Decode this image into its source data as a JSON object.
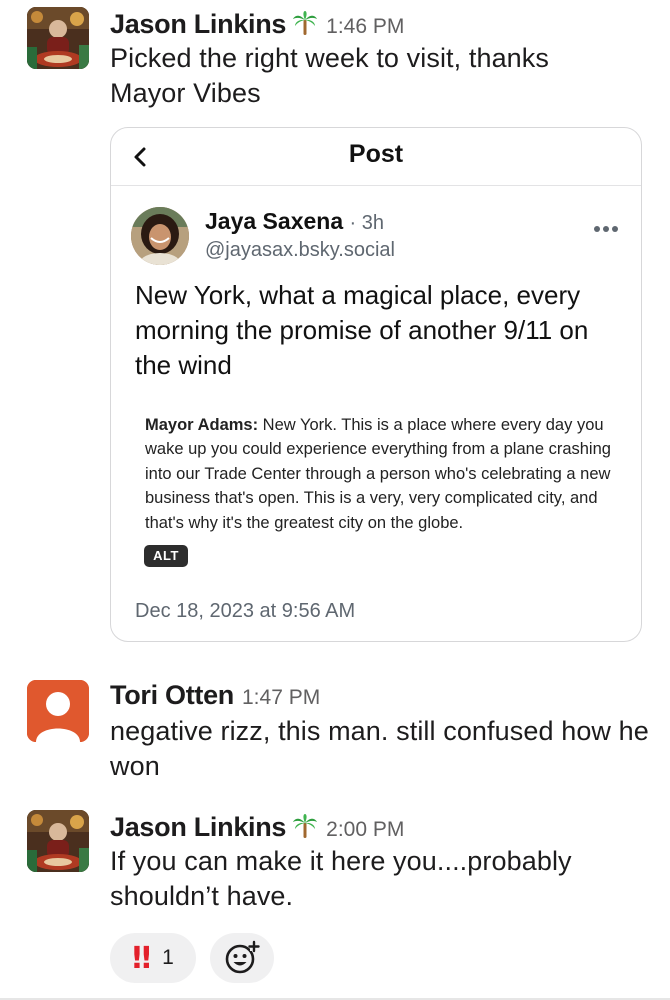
{
  "messages": [
    {
      "sender": "Jason Linkins",
      "status_emoji": "palm-tree-icon",
      "time": "1:46 PM",
      "text": "Picked the right week to visit, thanks Mayor Vibes"
    },
    {
      "sender": "Tori Otten",
      "time": "1:47 PM",
      "text": "negative rizz, this man. still confused how he won"
    },
    {
      "sender": "Jason Linkins",
      "status_emoji": "palm-tree-icon",
      "time": "2:00 PM",
      "text": "If you can make it here you....probably shouldn’t have."
    }
  ],
  "embed": {
    "title": "Post",
    "author_name": "Jaya Saxena",
    "age": "· 3h",
    "handle": "@jayasax.bsky.social",
    "text": "New York, what a magical place, every morning the promise of another 9/11 on the wind",
    "quote_speaker": "Mayor Adams:",
    "quote_text": " New York. This is a place where every day you wake up you could experience everything from a plane crashing into our Trade Center through a person who's celebrating a new business that's open. This is a very, very complicated city, and that's why it's the greatest city on the globe.",
    "alt_label": "ALT",
    "date": "Dec 18, 2023 at 9:56 AM"
  },
  "reactions": [
    {
      "emoji": "‼",
      "icon": "double-exclamation-icon",
      "count": "1"
    },
    {
      "icon": "add-reaction-icon"
    }
  ],
  "colors": {
    "reaction_red": "#e3202b",
    "tori_avatar": "#e0582e",
    "muted_text": "#616061"
  }
}
